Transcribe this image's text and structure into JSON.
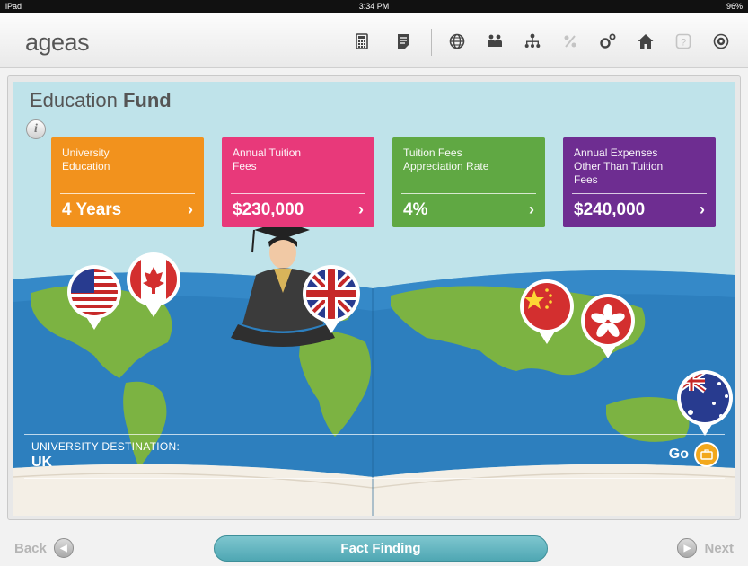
{
  "status_bar": {
    "device": "iPad",
    "time": "3:34 PM",
    "battery": "96%"
  },
  "header": {
    "logo": "ageas",
    "toolbar_icons": [
      "calculator-icon",
      "notes-icon",
      "globe-icon",
      "family-icon",
      "org-chart-icon",
      "percent-icon",
      "gear-icon",
      "home-icon",
      "help-icon",
      "power-icon"
    ]
  },
  "page": {
    "title_light": "Education",
    "title_bold": "Fund",
    "info_glyph": "i"
  },
  "cards": [
    {
      "label": "University Education",
      "value": "4 Years",
      "color": "#f2921d"
    },
    {
      "label": "Annual Tuition Fees",
      "value": "$230,000",
      "color": "#e8397a"
    },
    {
      "label": "Tuition Fees Appreciation Rate",
      "value": "4%",
      "color": "#60a843"
    },
    {
      "label": "Annual Expenses Other Than Tuition Fees",
      "value": "$240,000",
      "color": "#6e2d91"
    }
  ],
  "card_arrow": "›",
  "map": {
    "flags": [
      "USA",
      "Canada",
      "UK",
      "China",
      "Hong Kong",
      "Australia"
    ],
    "selected": "UK"
  },
  "destination": {
    "label": "UNIVERSITY DESTINATION:",
    "value": "UK",
    "go_label": "Go"
  },
  "footer": {
    "back": "Back",
    "center": "Fact Finding",
    "next": "Next"
  }
}
